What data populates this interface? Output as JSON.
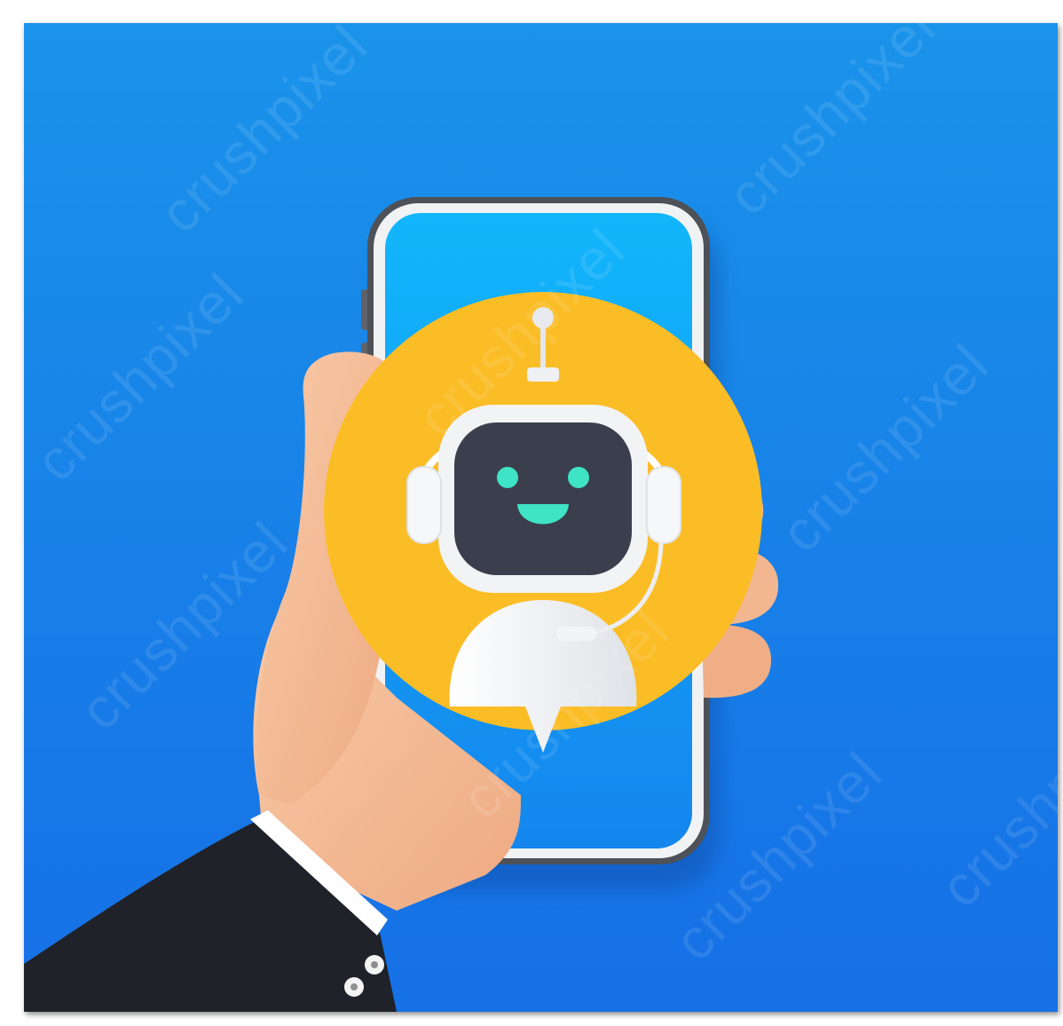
{
  "image": {
    "subject": "chatbot",
    "palette": {
      "background_top": "#1a93ea",
      "background_bottom": "#1670e6",
      "screen_top": "#12b6fb",
      "screen_bottom": "#1486ee",
      "circle": "#fbbd26",
      "robot_face": "#3b3f4d",
      "robot_eyes": "#3fe3c6",
      "robot_shell": "#f2f3f5",
      "skin": "#f5be98",
      "sleeve": "#1f2228"
    }
  },
  "watermark": {
    "text": "crushpixel",
    "mark": "®"
  }
}
